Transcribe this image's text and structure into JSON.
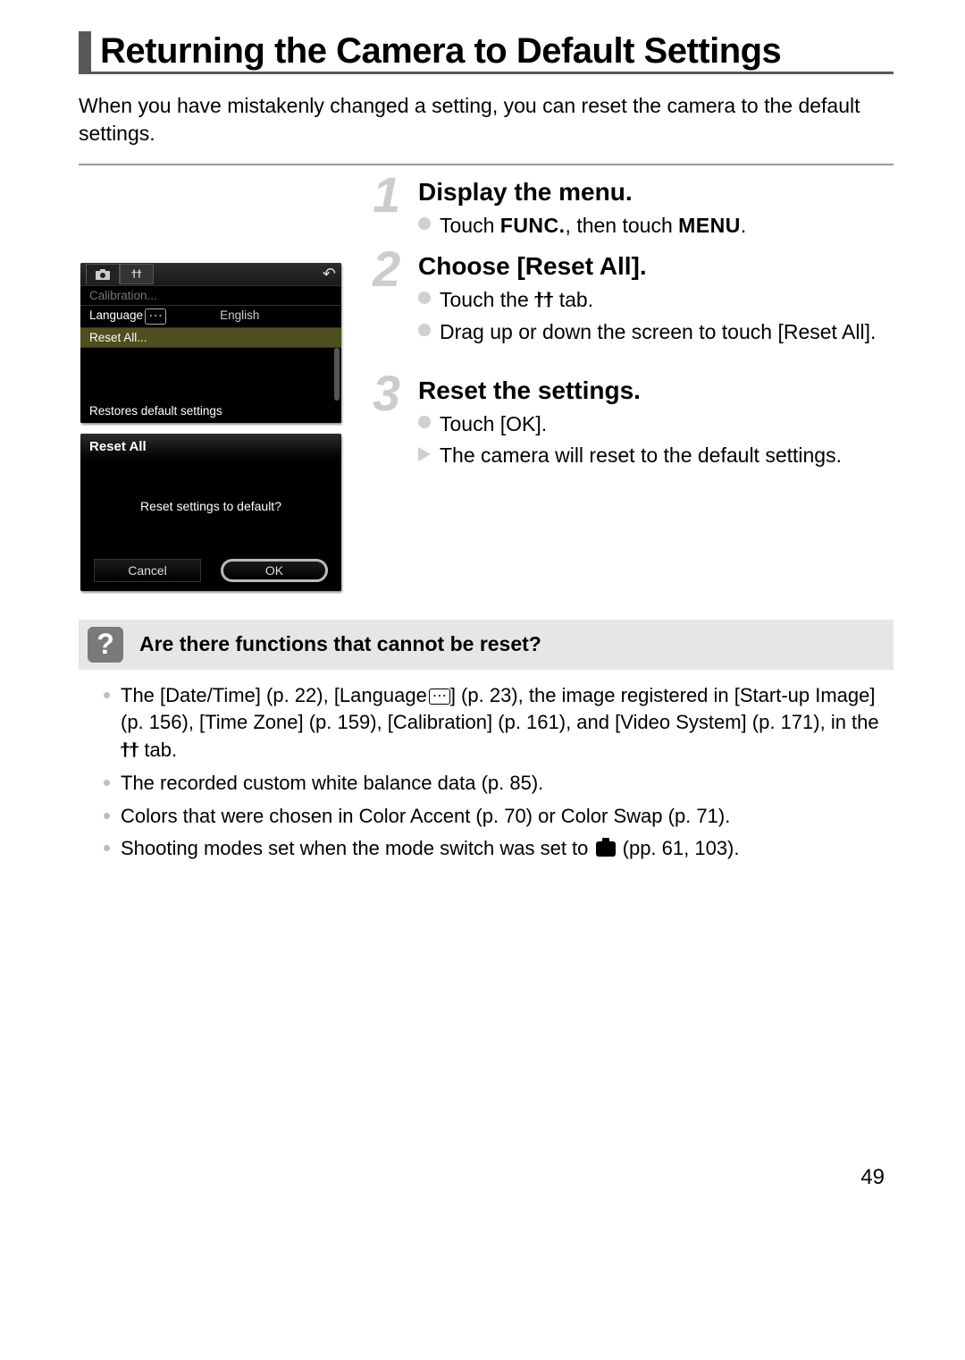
{
  "page": {
    "title": "Returning the Camera to Default Settings",
    "intro": "When you have mistakenly changed a setting, you can reset the camera to the default settings.",
    "page_number": "49"
  },
  "steps": [
    {
      "num": "1",
      "title": "Display the menu.",
      "items": [
        {
          "kind": "dot",
          "pre": "Touch ",
          "sc1": "FUNC.",
          "mid": ", then touch ",
          "sc2": "MENU",
          "post": "."
        }
      ]
    },
    {
      "num": "2",
      "title": "Choose [Reset All].",
      "items": [
        {
          "kind": "dot",
          "pre": "Touch the ",
          "tools": true,
          "post": " tab."
        },
        {
          "kind": "dot",
          "pre": "Drag up or down the screen to touch [Reset All]."
        }
      ]
    },
    {
      "num": "3",
      "title": "Reset the settings.",
      "items": [
        {
          "kind": "dot",
          "pre": "Touch [OK]."
        },
        {
          "kind": "arrow",
          "pre": "The camera will reset to the default settings."
        }
      ]
    }
  ],
  "screenshot1": {
    "row_calibration": "Calibration...",
    "row_language": "Language",
    "row_language_value": "English",
    "row_reset": "Reset All...",
    "status": "Restores default settings"
  },
  "screenshot2": {
    "header": "Reset All",
    "question": "Reset settings to default?",
    "cancel": "Cancel",
    "ok": "OK"
  },
  "callout": {
    "title": "Are there functions that cannot be reset?"
  },
  "notes": {
    "n1a": "The [Date/Time] (p. 22), [Language",
    "n1b": "] (p. 23), the image registered in [Start-up Image] (p. 156), [Time Zone] (p. 159), [Calibration] (p. 161), and [Video System] (p. 171), in the ",
    "n1c": " tab.",
    "n2": "The recorded custom white balance data (p. 85).",
    "n3": "Colors that were chosen in Color Accent (p. 70) or Color Swap (p. 71).",
    "n4a": "Shooting modes set when the mode switch was set to ",
    "n4b": " (pp. 61, 103)."
  }
}
